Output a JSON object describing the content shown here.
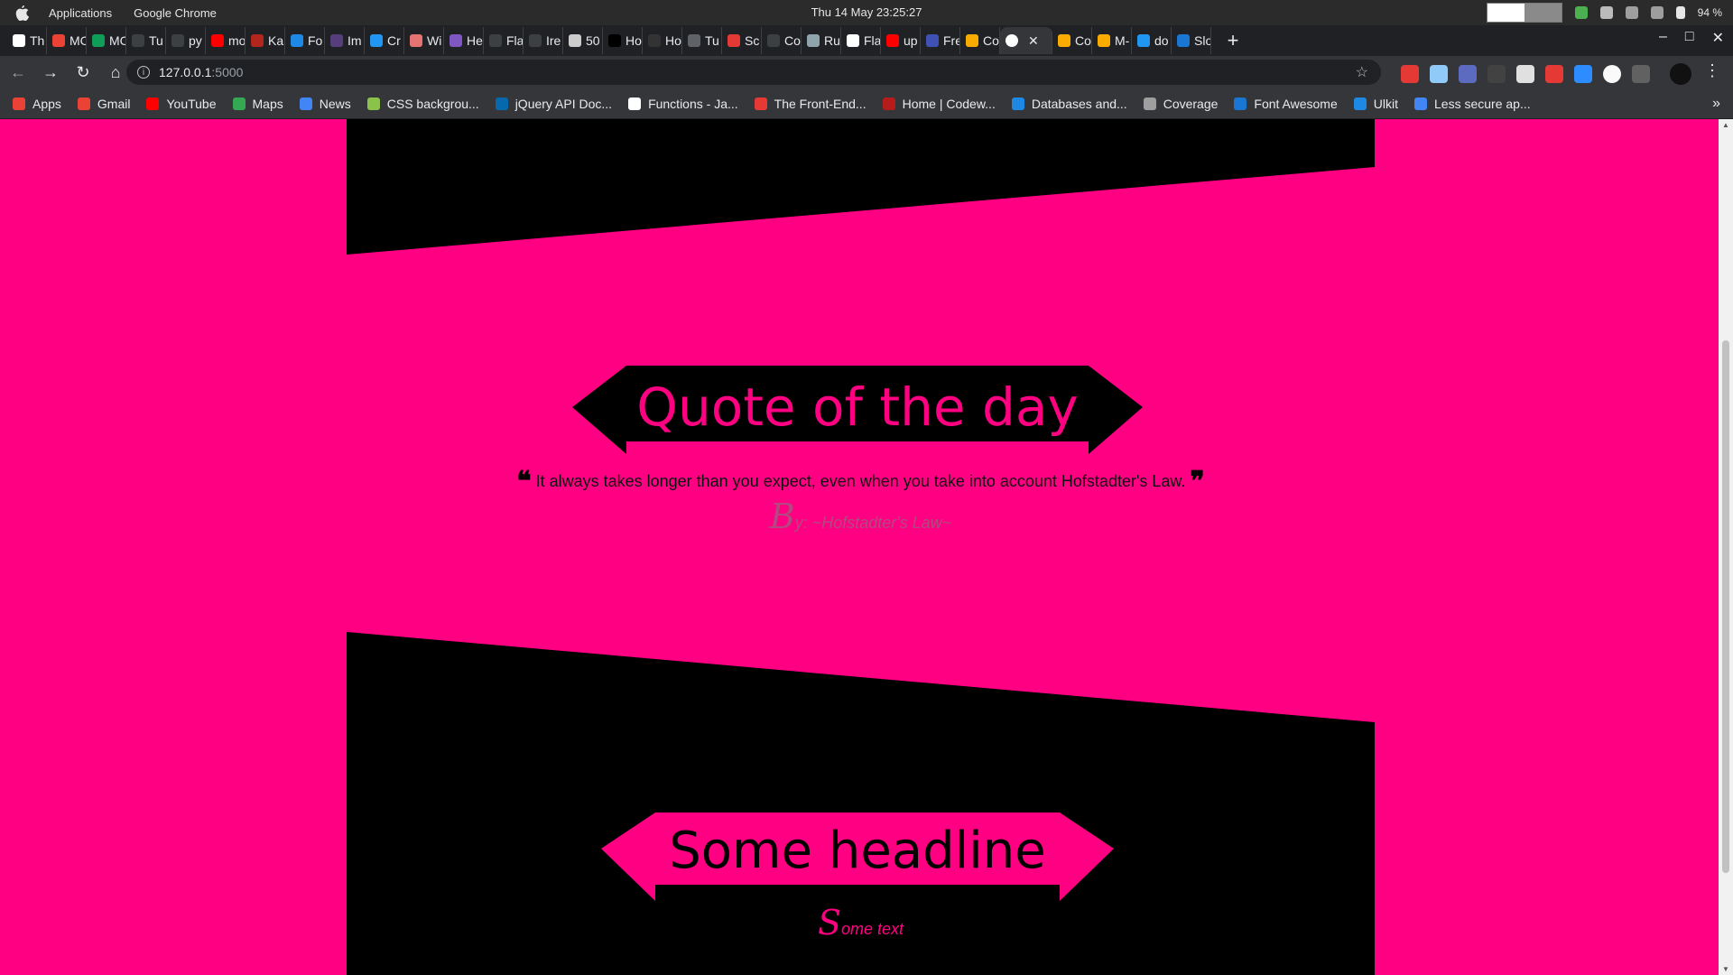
{
  "os": {
    "menus": [
      "Applications",
      "Google Chrome"
    ],
    "clock": "Thu 14 May  23:25:27",
    "battery": "94 %"
  },
  "browser": {
    "tabs": [
      {
        "label": "Th",
        "color": "#ffffff"
      },
      {
        "label": "MC",
        "color": "#ea4335"
      },
      {
        "label": "MC",
        "color": "#0f9d58"
      },
      {
        "label": "Tu",
        "color": "#3c4043"
      },
      {
        "label": "py",
        "color": "#3c4043"
      },
      {
        "label": "mo",
        "color": "#ff0000"
      },
      {
        "label": "Ka",
        "color": "#b3261e"
      },
      {
        "label": "Fo",
        "color": "#1e88e5"
      },
      {
        "label": "Im",
        "color": "#563d7c"
      },
      {
        "label": "Cr",
        "color": "#2196f3"
      },
      {
        "label": "Wi",
        "color": "#e57373"
      },
      {
        "label": "He",
        "color": "#7e57c2"
      },
      {
        "label": "Fla",
        "color": "#3c4043"
      },
      {
        "label": "Ire",
        "color": "#3c4043"
      },
      {
        "label": "50",
        "color": "#cccccc"
      },
      {
        "label": "Ho",
        "color": "#000000"
      },
      {
        "label": "Ho",
        "color": "#333333"
      },
      {
        "label": "Tu",
        "color": "#5f6368"
      },
      {
        "label": "Sc",
        "color": "#e53935"
      },
      {
        "label": "Co",
        "color": "#3c4043"
      },
      {
        "label": "Ru",
        "color": "#90a4ae"
      },
      {
        "label": "Fla",
        "color": "#ffffff"
      },
      {
        "label": "up",
        "color": "#ff0000"
      },
      {
        "label": "Fre",
        "color": "#3f51b5"
      },
      {
        "label": "Co",
        "color": "#f9ab00"
      },
      {
        "label": "",
        "color": "#ffffff",
        "active": true
      },
      {
        "label": "Co",
        "color": "#f9ab00"
      },
      {
        "label": "M-",
        "color": "#f9ab00"
      },
      {
        "label": "do",
        "color": "#2196f3"
      },
      {
        "label": "Slo",
        "color": "#1976d2"
      }
    ],
    "new_tab": "+",
    "url_host": "127.0.0.1",
    "url_port": ":5000",
    "bookmarks": [
      {
        "label": "Apps",
        "color": "#ea4335"
      },
      {
        "label": "Gmail",
        "color": "#ea4335"
      },
      {
        "label": "YouTube",
        "color": "#ff0000"
      },
      {
        "label": "Maps",
        "color": "#34a853"
      },
      {
        "label": "News",
        "color": "#4285f4"
      },
      {
        "label": "CSS backgrou...",
        "color": "#8bc34a"
      },
      {
        "label": "jQuery API Doc...",
        "color": "#0769ad"
      },
      {
        "label": "Functions - Ja...",
        "color": "#ffffff"
      },
      {
        "label": "The Front-End...",
        "color": "#e53935"
      },
      {
        "label": "Home | Codew...",
        "color": "#b71c1c"
      },
      {
        "label": "Databases and...",
        "color": "#1e88e5"
      },
      {
        "label": "Coverage",
        "color": "#9e9e9e"
      },
      {
        "label": "Font Awesome",
        "color": "#1976d2"
      },
      {
        "label": "Ulkit",
        "color": "#1e88e5"
      },
      {
        "label": "Less secure ap...",
        "color": "#4285f4"
      }
    ]
  },
  "page": {
    "quote_title": "Quote of the day",
    "quote_open": "❝",
    "quote_text": "It always takes longer than you expect, even when you take into account Hofstadter's Law.",
    "quote_close": "❞",
    "by_cap": "B",
    "by_rest": "y: ~Hofstadter's Law~",
    "headline": "Some headline",
    "text_cap": "S",
    "text_rest": "ome text",
    "colors": {
      "pink": "#ff0082",
      "black": "#000000"
    }
  }
}
